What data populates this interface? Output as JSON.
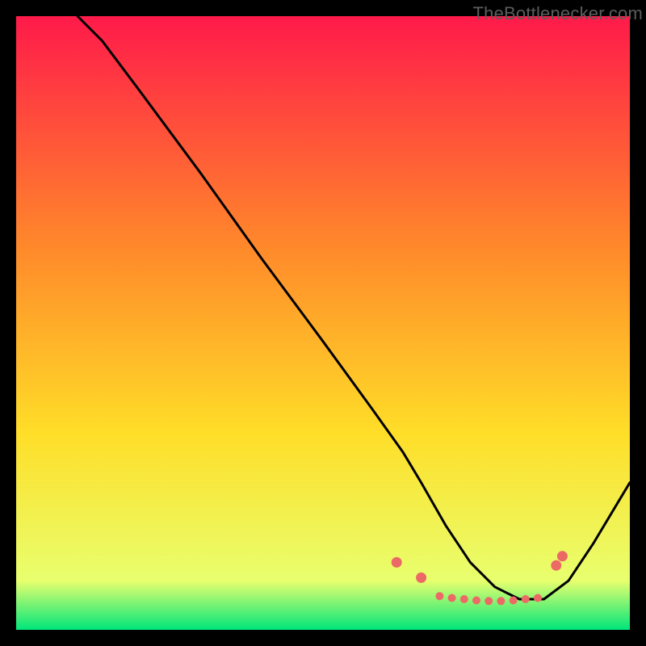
{
  "watermark": {
    "text": "TheBottlenecker.com"
  },
  "chart_data": {
    "type": "line",
    "title": "",
    "xlabel": "",
    "ylabel": "",
    "xlim": [
      0,
      100
    ],
    "ylim": [
      0,
      100
    ],
    "grid": false,
    "legend": false,
    "background_gradient": {
      "top": "#ff1a4a",
      "mid": "#ffde28",
      "band": "#e8ff6e",
      "bottom": "#00e67a"
    },
    "series": [
      {
        "name": "bottleneck-curve",
        "color": "#000000",
        "x": [
          10,
          14,
          20,
          30,
          40,
          50,
          58,
          63,
          66,
          70,
          74,
          78,
          82,
          86,
          90,
          94,
          100
        ],
        "y": [
          100,
          96,
          88,
          74.5,
          60.5,
          47,
          36,
          29,
          24,
          17,
          11,
          7,
          5,
          5,
          8,
          14,
          24
        ]
      }
    ],
    "markers": {
      "name": "highlight-points",
      "color": "#ec6a66",
      "radius_main": 6.5,
      "radius_small": 5,
      "points": [
        {
          "x": 62,
          "y": 11,
          "r": 6.5
        },
        {
          "x": 66,
          "y": 8.5,
          "r": 6.5
        },
        {
          "x": 69,
          "y": 5.5,
          "r": 5
        },
        {
          "x": 71,
          "y": 5.2,
          "r": 5
        },
        {
          "x": 73,
          "y": 5.0,
          "r": 5
        },
        {
          "x": 75,
          "y": 4.8,
          "r": 5
        },
        {
          "x": 77,
          "y": 4.7,
          "r": 5
        },
        {
          "x": 79,
          "y": 4.7,
          "r": 5
        },
        {
          "x": 81,
          "y": 4.8,
          "r": 5
        },
        {
          "x": 83,
          "y": 5.0,
          "r": 5
        },
        {
          "x": 85,
          "y": 5.2,
          "r": 5
        },
        {
          "x": 88,
          "y": 10.5,
          "r": 6.5
        },
        {
          "x": 89,
          "y": 12.0,
          "r": 6.5
        }
      ]
    }
  }
}
